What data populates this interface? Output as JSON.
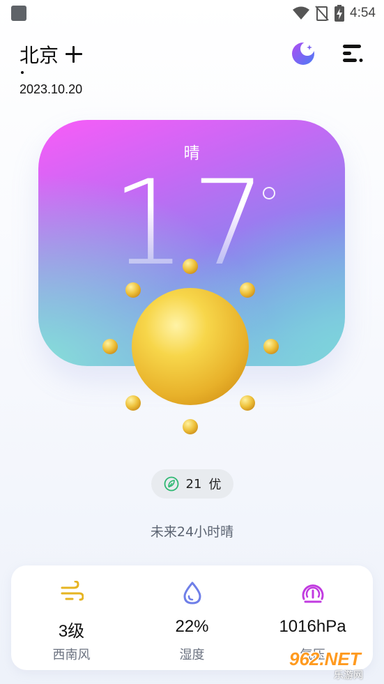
{
  "status_bar": {
    "time": "4:54",
    "icons": [
      "app-notification-icon",
      "wifi-icon",
      "no-signal-icon",
      "battery-charging-icon"
    ]
  },
  "header": {
    "city": "北京",
    "date": "2023.10.20",
    "add_city_icon": "plus-icon",
    "theme_icon": "moon-star-icon",
    "menu_icon": "menu-icon"
  },
  "weather": {
    "condition": "晴",
    "temperature": "17",
    "illustration": "sun-icon",
    "colors": {
      "card_pink": "#f95cf8",
      "card_purple": "#8a83ee",
      "card_teal": "#86e0d8",
      "sun_yellow": "#f2c53a"
    }
  },
  "aqi": {
    "value": "21",
    "level": "优",
    "icon": "leaf-icon",
    "color": "#2eb872"
  },
  "forecast": "未来24小时晴",
  "details": [
    {
      "icon": "wind-icon",
      "value": "3级",
      "label": "西南风",
      "color": "#e6b422"
    },
    {
      "icon": "water-drop-icon",
      "value": "22%",
      "label": "湿度",
      "color": "#6f7fe8"
    },
    {
      "icon": "pressure-gauge-icon",
      "value": "1016hPa",
      "label": "气压",
      "color": "#c13be0"
    }
  ],
  "watermark": {
    "main": "962.NET",
    "sub": "乐游网"
  }
}
